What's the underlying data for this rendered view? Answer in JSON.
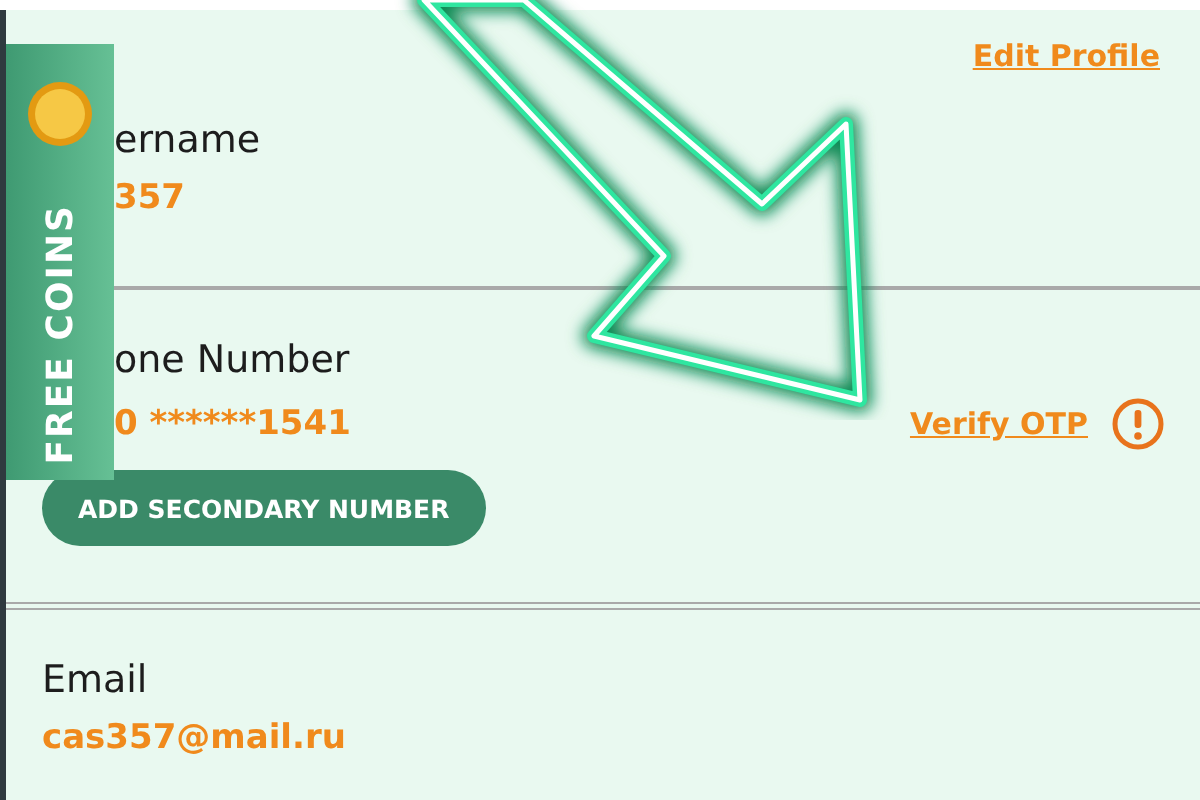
{
  "edit_profile_link": "Edit Profile",
  "sections": [
    {
      "label": "ername",
      "value": "357",
      "partly_covered": true
    },
    {
      "label": "one Number",
      "value": "0 ******1541",
      "partly_covered": true,
      "verify_link": "Verify OTP",
      "button": "ADD SECONDARY NUMBER"
    },
    {
      "label": "Email",
      "value": "cas357@mail.ru",
      "partly_covered": false
    }
  ],
  "free_coins_tab": {
    "label": "FREE COINS"
  }
}
